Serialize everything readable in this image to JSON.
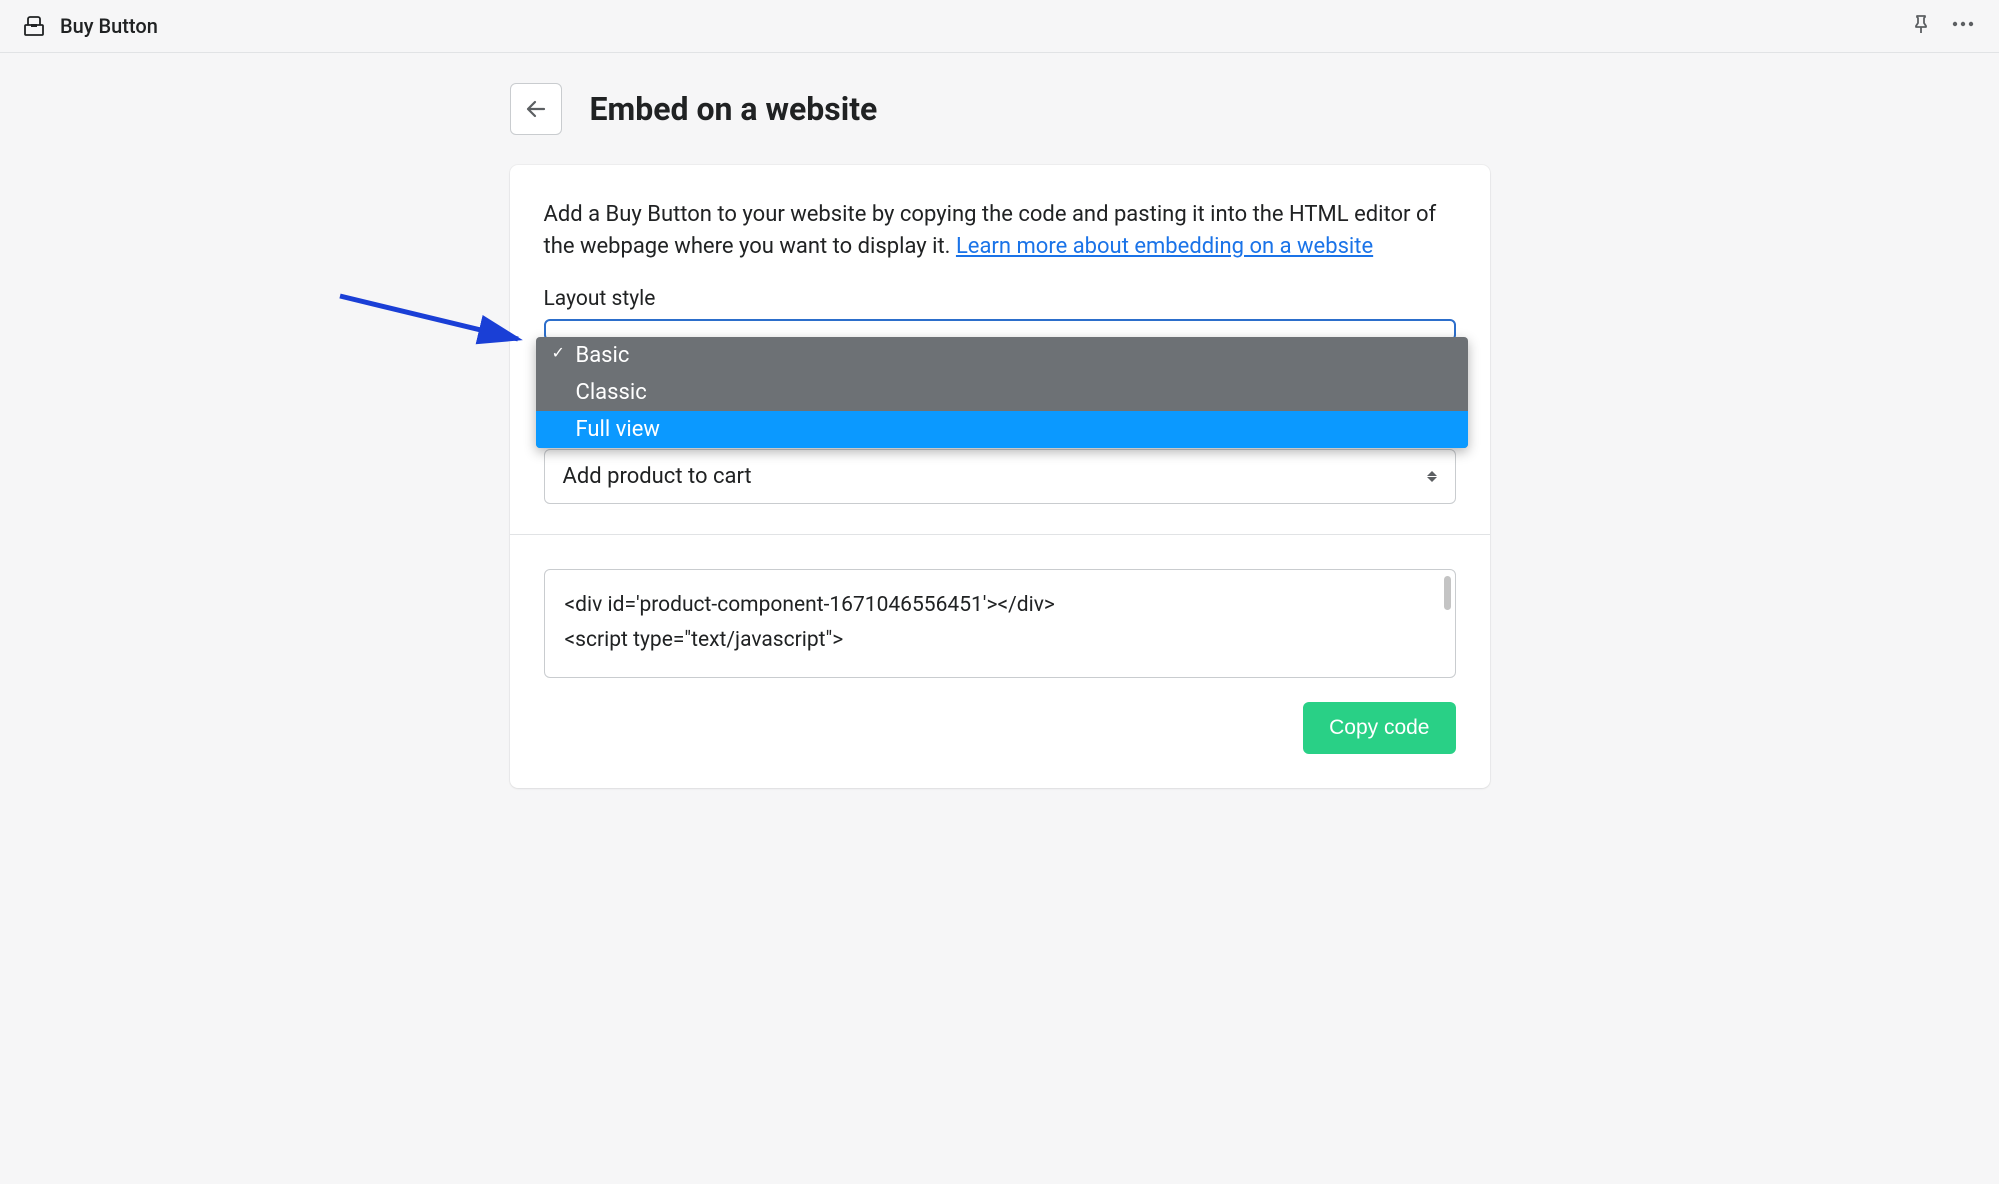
{
  "topbar": {
    "app_title": "Buy Button"
  },
  "page": {
    "title": "Embed on a website",
    "intro_text": "Add a Buy Button to your website by copying the code and pasting it into the HTML editor of the webpage where you want to display it. ",
    "intro_link": "Learn more about embedding on a website"
  },
  "layout_style": {
    "label": "Layout style",
    "options": [
      "Basic",
      "Classic",
      "Full view"
    ],
    "selected": "Basic",
    "highlighted": "Full view"
  },
  "action_select": {
    "value": "Add product to cart"
  },
  "code": {
    "line1": "<div id='product-component-1671046556451'></div>",
    "line2": "<script type=\"text/javascript\">"
  },
  "copy_button": {
    "label": "Copy code"
  }
}
